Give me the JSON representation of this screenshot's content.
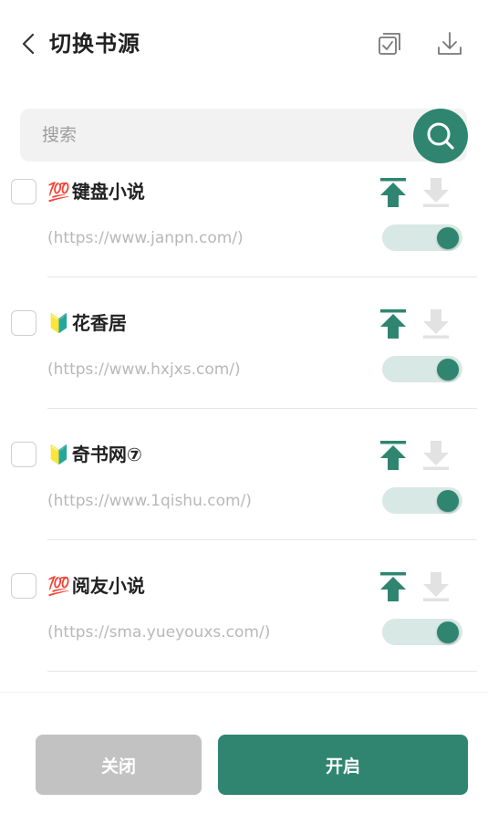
{
  "header": {
    "title": "切换书源",
    "back_icon": "chevron-left-icon",
    "select_all_icon": "checkbox-stack-icon",
    "import_icon": "download-icon"
  },
  "search": {
    "placeholder": "搜索",
    "value": "",
    "icon": "search-icon"
  },
  "sources": [
    {
      "badge": "💯",
      "name": "键盘小说",
      "url": "(https://www.janpn.com/)",
      "enabled": true,
      "checked": false
    },
    {
      "badge": "🔰",
      "name": "花香居",
      "url": "(https://www.hxjxs.com/)",
      "enabled": true,
      "checked": false
    },
    {
      "badge": "🔰",
      "name": "奇书网⑦",
      "url": "(https://www.1qishu.com/)",
      "enabled": true,
      "checked": false
    },
    {
      "badge": "💯",
      "name": "阅友小说",
      "url": "(https://sma.yueyouxs.com/)",
      "enabled": true,
      "checked": false
    }
  ],
  "footer": {
    "close_label": "关闭",
    "enable_label": "开启"
  },
  "colors": {
    "accent": "#2f8570",
    "accent_light": "#d8e8e4",
    "disabled_icon": "#e2e2e2",
    "close_button": "#c2c2c2"
  }
}
